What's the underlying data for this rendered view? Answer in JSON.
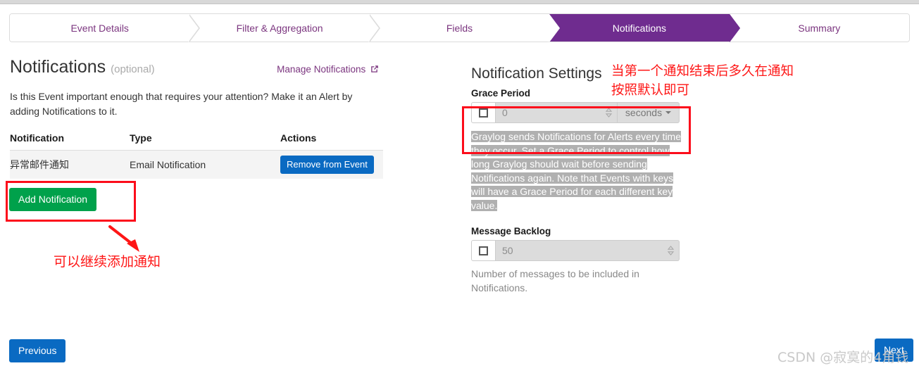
{
  "wizard": {
    "steps": [
      {
        "label": "Event Details",
        "active": false
      },
      {
        "label": "Filter & Aggregation",
        "active": false
      },
      {
        "label": "Fields",
        "active": false
      },
      {
        "label": "Notifications",
        "active": true
      },
      {
        "label": "Summary",
        "active": false
      }
    ]
  },
  "left": {
    "title": "Notifications",
    "title_optional": "(optional)",
    "manage_link": "Manage Notifications",
    "manage_link_icon": "external-link-icon",
    "intro": "Is this Event important enough that requires your attention? Make it an Alert by adding Notifications to it.",
    "table": {
      "headers": [
        "Notification",
        "Type",
        "Actions"
      ],
      "rows": [
        {
          "notification": "异常邮件通知",
          "type": "Email Notification",
          "action_label": "Remove from Event"
        }
      ]
    },
    "add_button": "Add Notification"
  },
  "right": {
    "title": "Notification Settings",
    "grace_period": {
      "label": "Grace Period",
      "checkbox_checked": false,
      "value_placeholder": "0",
      "unit": "seconds",
      "unit_caret_icon": "caret-down-icon",
      "spinner_icon": "spinner-up-down-icon",
      "help_text": "Graylog sends Notifications for Alerts every time they occur. Set a Grace Period to control how long Graylog should wait before sending Notifications again. Note that Events with keys will have a Grace Period for each different key value.",
      "help_text_selected": true
    },
    "message_backlog": {
      "label": "Message Backlog",
      "checkbox_checked": false,
      "value_placeholder": "50",
      "spinner_icon": "spinner-up-down-icon",
      "help_text": "Number of messages to be included in Notifications."
    }
  },
  "footer": {
    "previous": "Previous",
    "next": "Next"
  },
  "annotations": {
    "left_text": "可以继续添加通知",
    "right_text": "当第一个通知结束后多久在通知\n按照默认即可",
    "box_color": "#fc0d1b",
    "text_color": "#fe1616"
  },
  "watermark": "CSDN @寂寞的4角钱",
  "colors": {
    "accent_purple": "#6f2c8f",
    "primary_blue": "#0a6ac2",
    "success_green": "#00a14b",
    "annotation_red": "#fc0d1b"
  }
}
